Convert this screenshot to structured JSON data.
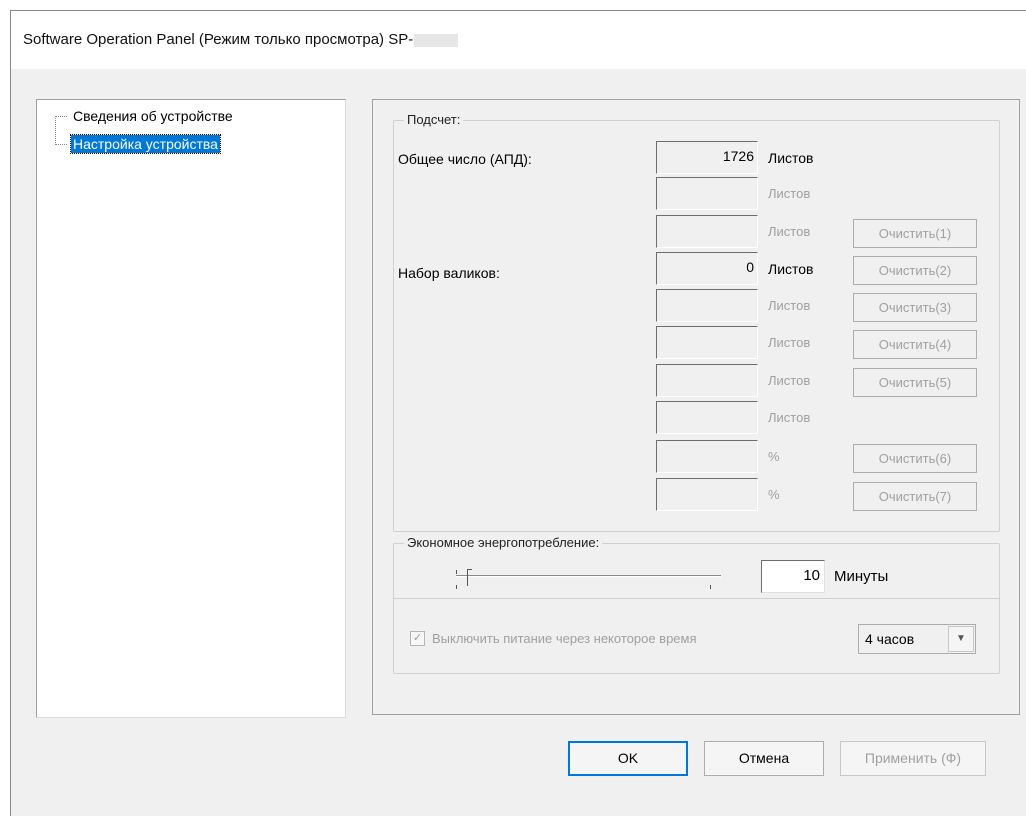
{
  "window": {
    "title": "Software Operation Panel (Режим только просмотра) SP-"
  },
  "tree": {
    "items": [
      {
        "label": "Сведения об устройстве",
        "selected": false
      },
      {
        "label": "Настройка устройства",
        "selected": true
      }
    ]
  },
  "counter": {
    "group_title": "Подсчет:",
    "total_label": "Общее число (АПД):",
    "roller_label": "Набор валиков:",
    "rows": [
      {
        "value": "1726",
        "unit": "Листов",
        "active": true,
        "clear": ""
      },
      {
        "value": "",
        "unit": "Листов",
        "active": false,
        "clear": ""
      },
      {
        "value": "",
        "unit": "Листов",
        "active": false,
        "clear": "Очистить(1)"
      },
      {
        "value": "0",
        "unit": "Листов",
        "active": true,
        "clear": "Очистить(2)"
      },
      {
        "value": "",
        "unit": "Листов",
        "active": false,
        "clear": "Очистить(3)"
      },
      {
        "value": "",
        "unit": "Листов",
        "active": false,
        "clear": "Очистить(4)"
      },
      {
        "value": "",
        "unit": "Листов",
        "active": false,
        "clear": "Очистить(5)"
      },
      {
        "value": "",
        "unit": "Листов",
        "active": false,
        "clear": ""
      },
      {
        "value": "",
        "unit": "%",
        "active": false,
        "clear": "Очистить(6)"
      },
      {
        "value": "",
        "unit": "%",
        "active": false,
        "clear": "Очистить(7)"
      }
    ]
  },
  "power": {
    "group_title": "Экономное энергопотребление:",
    "minutes_value": "10",
    "minutes_unit": "Минуты",
    "slider_level": 0.04,
    "auto_off_label": "Выключить питание через некоторое время",
    "auto_off_checked": true,
    "hours_value": "4 часов"
  },
  "buttons": {
    "ok": "OK",
    "cancel": "Отмена",
    "apply": "Применить (Ф)"
  }
}
